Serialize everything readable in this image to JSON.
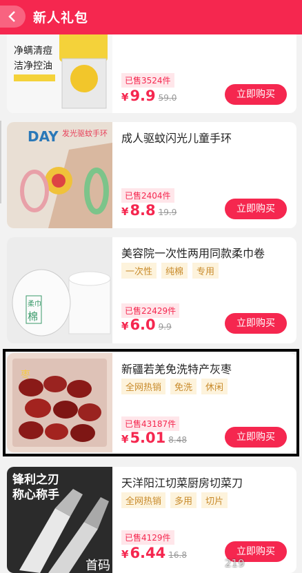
{
  "header": {
    "title": "新人礼包",
    "back_icon": "chevron-left-icon"
  },
  "buy_label": "立即购买",
  "currency": "¥",
  "products": [
    {
      "title": "",
      "tags": [],
      "sold": "已售3524件",
      "price": "9.9",
      "orig": "59.0",
      "thumb_text": [
        "净螨清痘",
        "洁净控油"
      ]
    },
    {
      "title": "成人驱蚊闪光儿童手环",
      "tags": [],
      "sold": "已售2404件",
      "price": "8.8",
      "orig": "19.9",
      "thumb_text": [
        "DAY",
        "发光驱蚊手环"
      ]
    },
    {
      "title": "美容院一次性两用同款柔巾卷",
      "tags": [
        "一次性",
        "纯棉",
        "专用"
      ],
      "sold": "已售22429件",
      "price": "6.0",
      "orig": "9.9",
      "thumb_text": [
        "柔巾",
        "棉"
      ]
    },
    {
      "title": "新疆若羌免洗特产灰枣",
      "tags": [
        "全网热销",
        "免洗",
        "休闲"
      ],
      "sold": "已售43187件",
      "price": "5.01",
      "orig": "8.48",
      "thumb_text": [
        "枣"
      ]
    },
    {
      "title": "天洋阳江切菜厨房切菜刀",
      "tags": [
        "全网热销",
        "多用",
        "切片"
      ],
      "sold": "已售4129件",
      "price": "6.44",
      "orig": "16.8",
      "thumb_text": [
        "锋利之刃",
        "称心称手"
      ]
    }
  ],
  "watermark": "首码",
  "watermark_tail": "219"
}
